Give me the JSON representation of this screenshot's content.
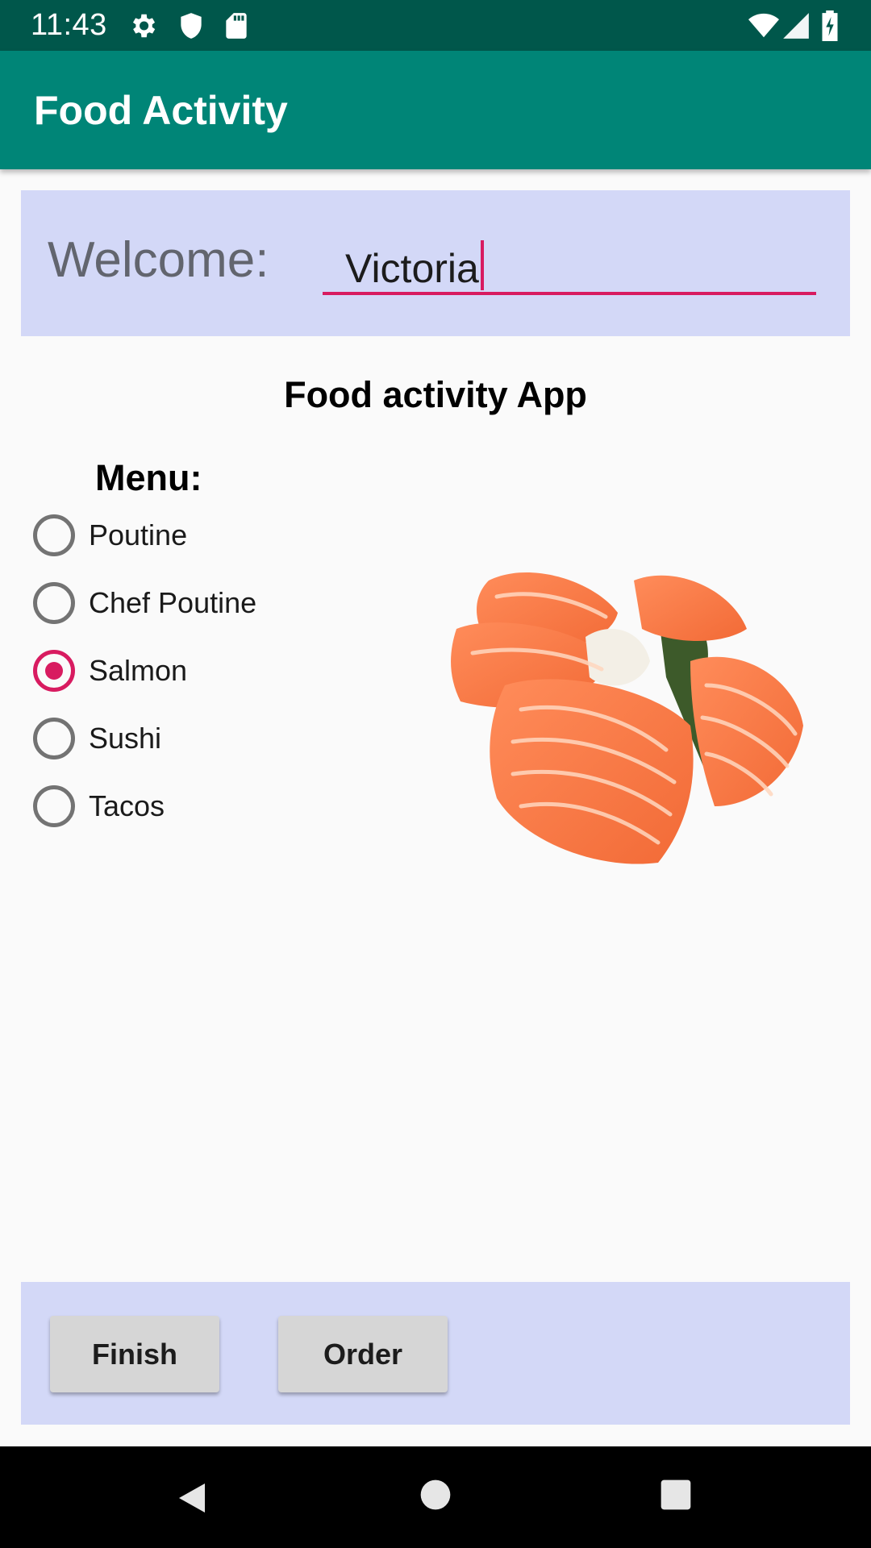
{
  "status_bar": {
    "time": "11:43",
    "icons": [
      "gear-icon",
      "shield-icon",
      "sd-card-icon",
      "wifi-icon",
      "signal-icon",
      "battery-icon"
    ]
  },
  "app_bar": {
    "title": "Food Activity",
    "color": "#008577"
  },
  "welcome": {
    "label": "Welcome:",
    "name_value": "Victoria"
  },
  "heading": "Food activity App",
  "menu": {
    "label": "Menu:",
    "options": [
      {
        "label": "Poutine",
        "checked": false
      },
      {
        "label": "Chef Poutine",
        "checked": false
      },
      {
        "label": "Salmon",
        "checked": true
      },
      {
        "label": "Sushi",
        "checked": false
      },
      {
        "label": "Tacos",
        "checked": false
      }
    ],
    "accent_color": "#d81b60"
  },
  "food_image": {
    "icon": "salmon-sashimi-image"
  },
  "buttons": {
    "finish": "Finish",
    "order": "Order"
  },
  "nav_bar": {
    "icons": [
      "back-icon",
      "home-icon",
      "recents-icon"
    ]
  }
}
